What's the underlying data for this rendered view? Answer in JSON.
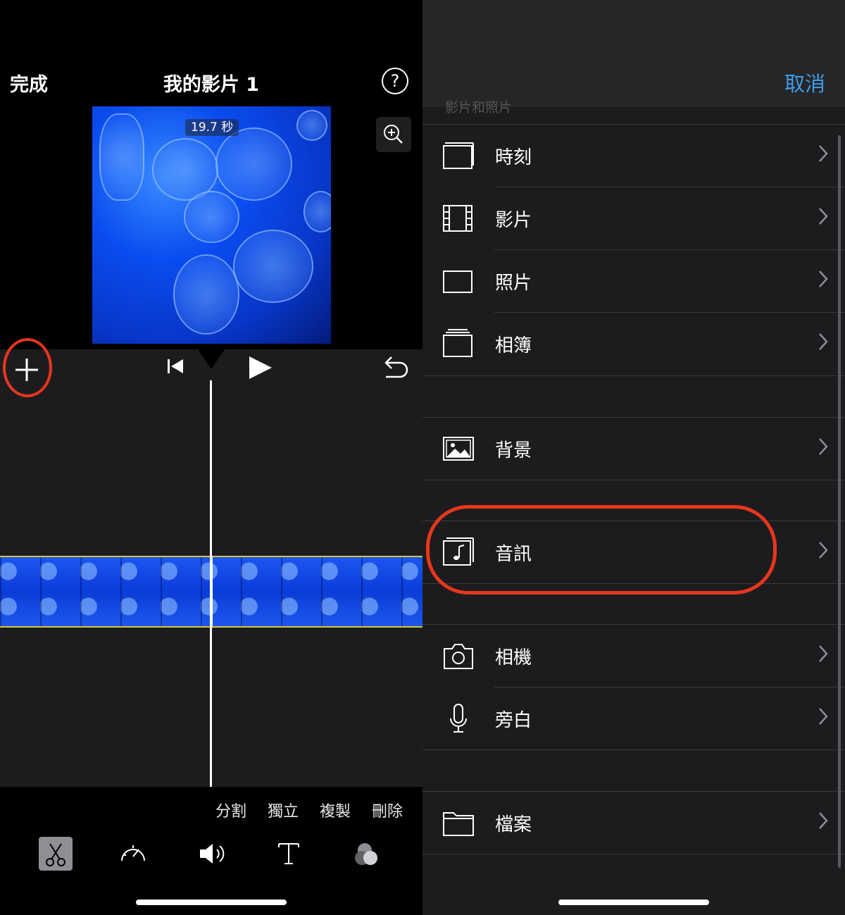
{
  "left": {
    "done_label": "完成",
    "title": "我的影片 1",
    "help_icon_text": "?",
    "duration": "19.7 秒",
    "edit_actions": [
      "分割",
      "獨立",
      "複製",
      "刪除"
    ],
    "tools": [
      "scissors-icon",
      "speed-icon",
      "volume-icon",
      "text-icon",
      "filter-icon"
    ]
  },
  "right": {
    "cancel_label": "取消",
    "faded_header": "影片和照片",
    "items": [
      {
        "label": "時刻",
        "icon": "moments-icon"
      },
      {
        "label": "影片",
        "icon": "film-icon"
      },
      {
        "label": "照片",
        "icon": "photo-icon"
      },
      {
        "label": "相簿",
        "icon": "album-icon"
      },
      {
        "label": "背景",
        "icon": "background-icon"
      },
      {
        "label": "音訊",
        "icon": "audio-icon"
      },
      {
        "label": "相機",
        "icon": "camera-icon"
      },
      {
        "label": "旁白",
        "icon": "microphone-icon"
      },
      {
        "label": "檔案",
        "icon": "folder-icon"
      }
    ]
  },
  "colors": {
    "accent_blue": "#3e9ce6",
    "highlight_red": "#e8361d",
    "clip_border": "#d8c23a"
  }
}
